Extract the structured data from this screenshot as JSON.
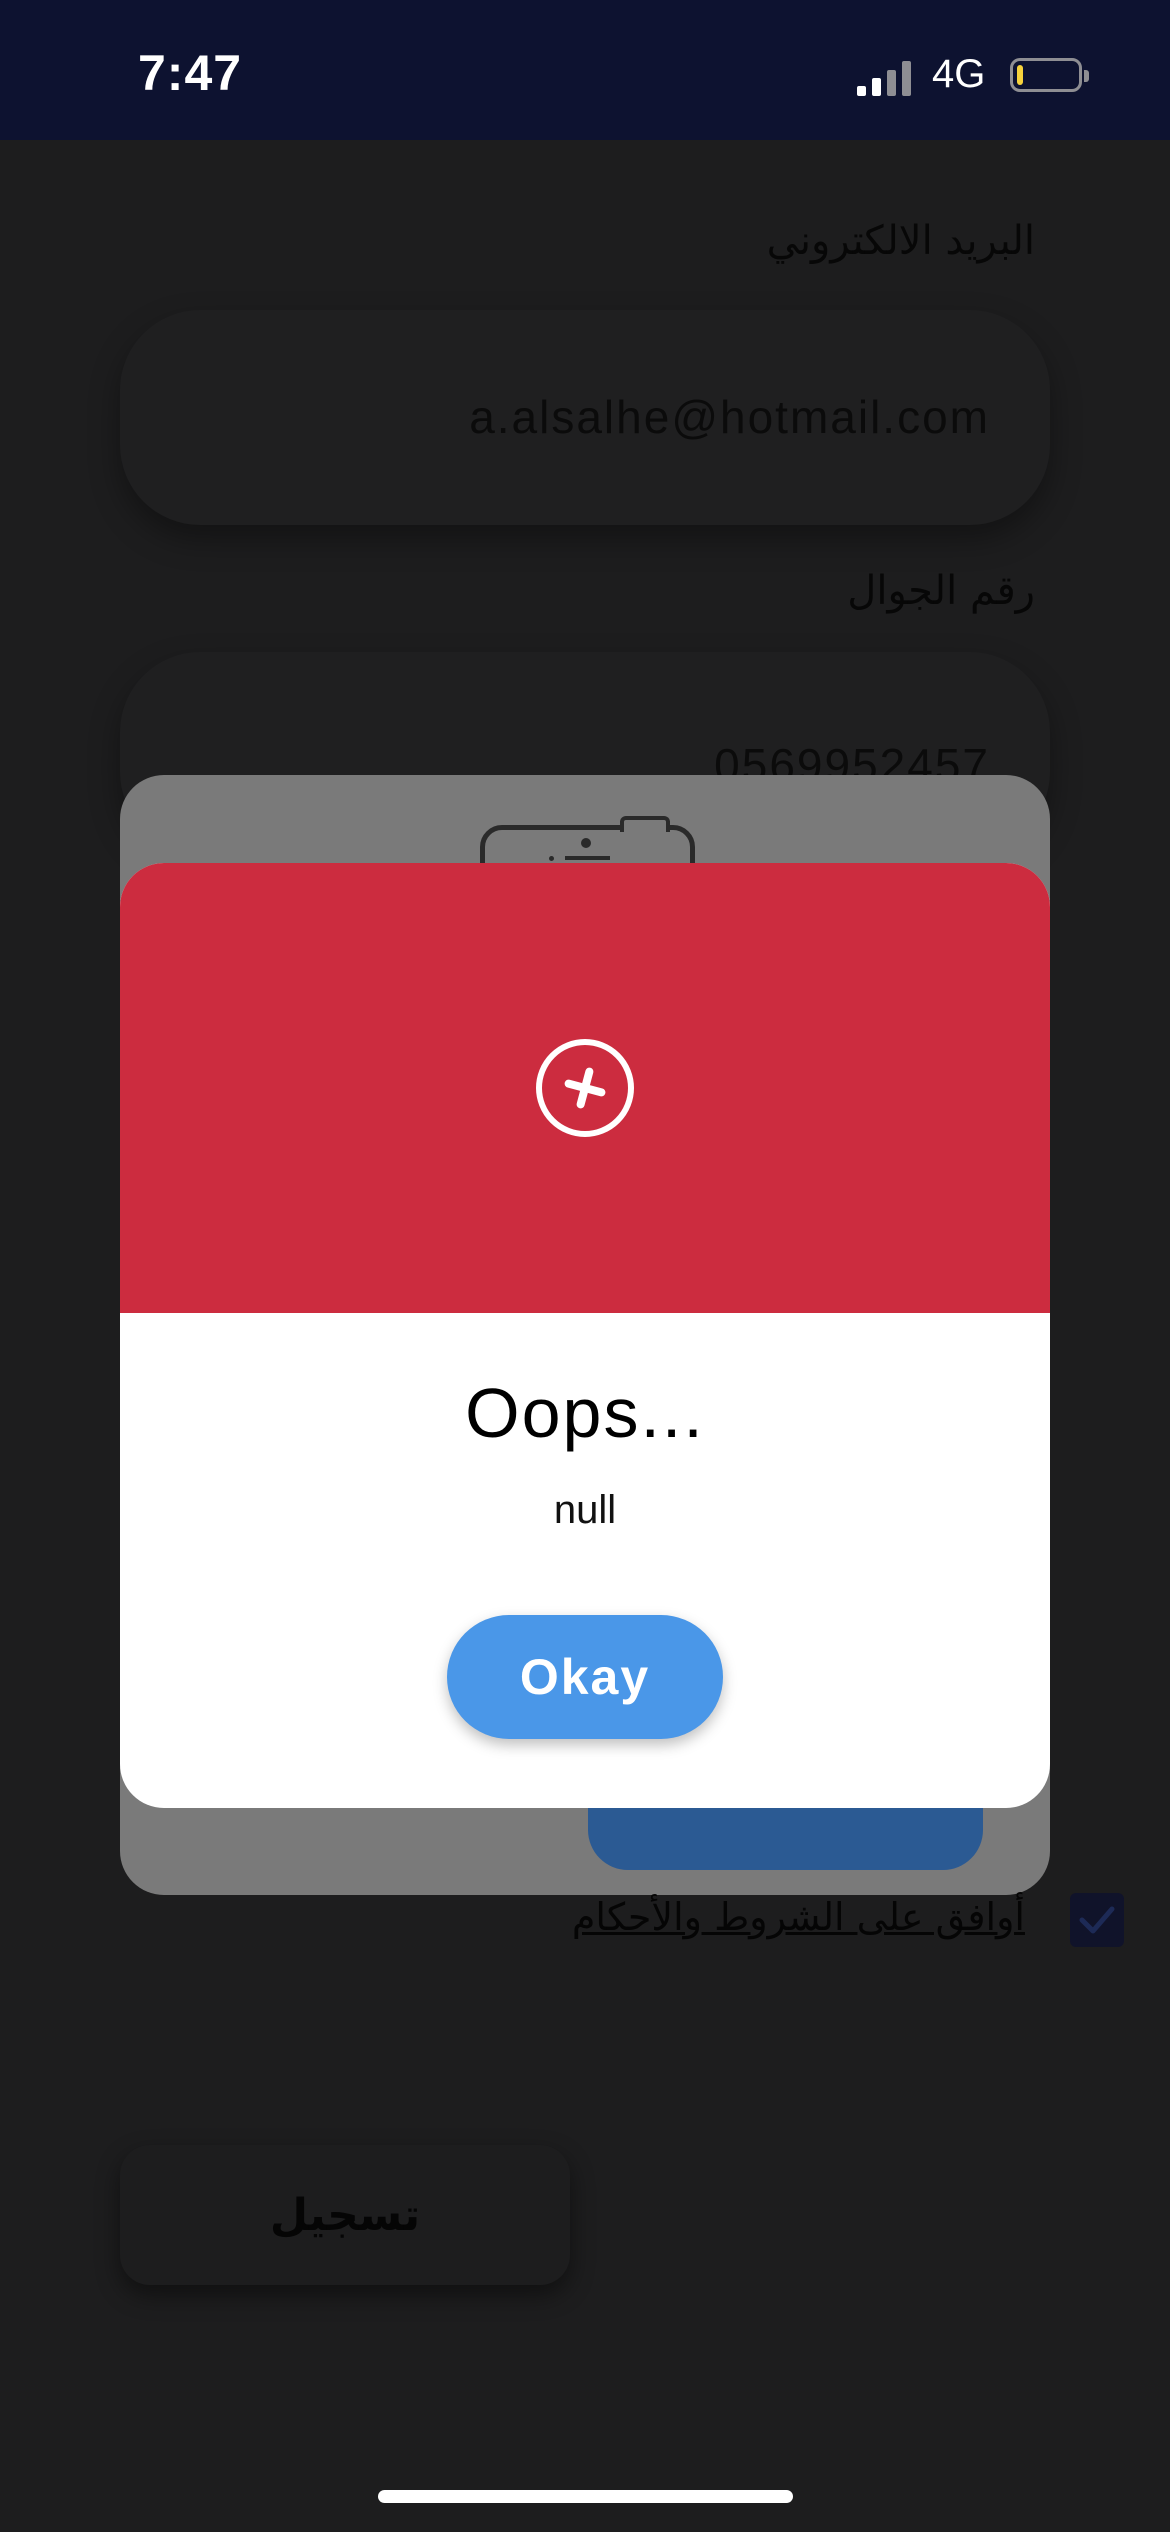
{
  "status_bar": {
    "time": "7:47",
    "network": "4G",
    "signal_icon": "cellular-signal-icon",
    "battery_icon": "battery-low-icon",
    "battery_level": 0.1,
    "battery_color": "#f6d23c"
  },
  "form": {
    "email_label": "البريد الالكتروني",
    "email_value": "a.alsalhe@hotmail.com",
    "phone_label": "رقم الجوال",
    "phone_value": "0569952457",
    "terms_label": "أوافق على الشروط والأحكام",
    "terms_checked": true,
    "register_label": "تسجيل"
  },
  "dialog": {
    "icon": "error-x-circle-icon",
    "header_color": "#cc2c3f",
    "title": "Oops...",
    "message": "null",
    "ok_label": "Okay",
    "ok_color": "#4a97e8"
  }
}
